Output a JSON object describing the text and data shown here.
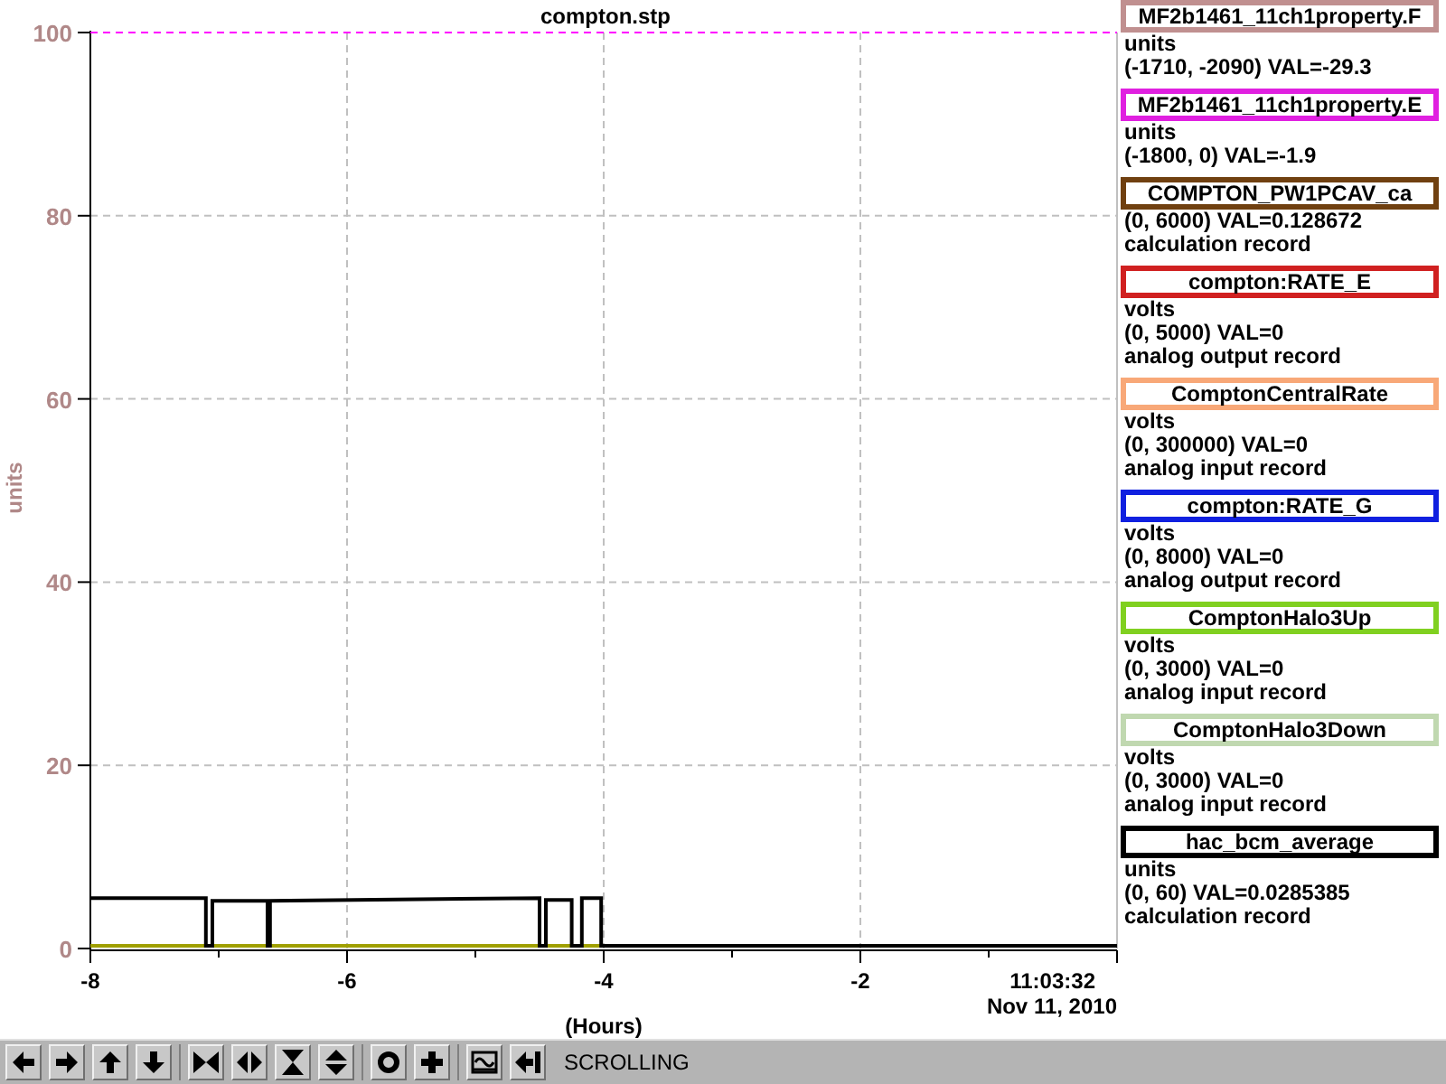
{
  "chart": {
    "title": "compton.stp",
    "chart_data": {
      "type": "line",
      "xlabel": "(Hours)",
      "ylabel": "units",
      "grid": true,
      "x": [
        -8,
        -7.1,
        -7.1,
        -7.05,
        -7.05,
        -6.62,
        -6.62,
        -6.6,
        -6.6,
        -4.5,
        -4.5,
        -4.45,
        -4.45,
        -4.25,
        -4.25,
        -4.17,
        -4.17,
        -4.02,
        -4.02,
        0
      ],
      "series": [
        {
          "color": "#ff00ff",
          "line_style": "dashed",
          "values": [
            100,
            100,
            100,
            100,
            100,
            100,
            100,
            100,
            100,
            100,
            100,
            100,
            100,
            100,
            100,
            100,
            100,
            100,
            100,
            100
          ]
        },
        {
          "color": "#a0a000",
          "line_style": "solid",
          "values": [
            0.3,
            0.3,
            0.3,
            0.3,
            0.3,
            0.3,
            0.3,
            0.3,
            0.3,
            0.3,
            0.3,
            0.3,
            0.3,
            0.3,
            0.3,
            0.3,
            0.3,
            0.3,
            0.3,
            null
          ]
        },
        {
          "color": "#000000",
          "line_style": "solid",
          "values": [
            5.5,
            5.5,
            0.3,
            0.3,
            5.2,
            5.2,
            0.3,
            0.3,
            5.2,
            5.5,
            0.3,
            0.3,
            5.3,
            5.3,
            0.3,
            0.3,
            5.5,
            5.5,
            0.3,
            0.3
          ]
        }
      ],
      "xlim": [
        -8,
        0
      ],
      "ylim": [
        0,
        100
      ],
      "xticks": [
        -8,
        -6,
        -4,
        -2
      ],
      "yticks": [
        0,
        20,
        40,
        60,
        80,
        100
      ]
    },
    "time": "11:03:32",
    "date": "Nov 11, 2010"
  },
  "legend": [
    {
      "name": "MF2b1461_11ch1property.F",
      "color": "#c09090",
      "lines": [
        "units",
        "(-1710, -2090) VAL=-29.3"
      ]
    },
    {
      "name": "MF2b1461_11ch1property.E",
      "color": "#e020e0",
      "lines": [
        "units",
        "(-1800, 0) VAL=-1.9"
      ]
    },
    {
      "name": "COMPTON_PW1PCAV_ca",
      "color": "#704010",
      "lines": [
        "(0, 6000) VAL=0.128672",
        "calculation record"
      ]
    },
    {
      "name": "compton:RATE_E",
      "color": "#d02020",
      "lines": [
        "volts",
        "(0, 5000) VAL=0",
        "analog output record"
      ]
    },
    {
      "name": "ComptonCentralRate",
      "color": "#f8a878",
      "lines": [
        "volts",
        "(0, 300000) VAL=0",
        "analog input record"
      ]
    },
    {
      "name": "compton:RATE_G",
      "color": "#1020e0",
      "lines": [
        "volts",
        "(0, 8000) VAL=0",
        "analog output record"
      ]
    },
    {
      "name": "ComptonHalo3Up",
      "color": "#80d020",
      "lines": [
        "volts",
        "(0, 3000) VAL=0",
        "analog input record"
      ]
    },
    {
      "name": "ComptonHalo3Down",
      "color": "#c0d8b0",
      "lines": [
        "volts",
        "(0, 3000) VAL=0",
        "analog input record"
      ]
    },
    {
      "name": "hac_bcm_average",
      "color": "#000000",
      "lines": [
        "units",
        "(0, 60) VAL=0.0285385",
        "calculation record"
      ]
    }
  ],
  "toolbar": {
    "groups": [
      {
        "buttons": [
          {
            "kind": "left"
          },
          {
            "kind": "right"
          },
          {
            "kind": "up"
          },
          {
            "kind": "down"
          }
        ]
      },
      {
        "buttons": [
          {
            "kind": "hin"
          },
          {
            "kind": "hout"
          },
          {
            "kind": "vin"
          },
          {
            "kind": "vout"
          }
        ]
      },
      {
        "buttons": [
          {
            "kind": "ring"
          },
          {
            "kind": "plus"
          }
        ]
      },
      {
        "buttons": [
          {
            "kind": "wave"
          },
          {
            "kind": "back"
          }
        ]
      }
    ],
    "status": "SCROLLING"
  }
}
